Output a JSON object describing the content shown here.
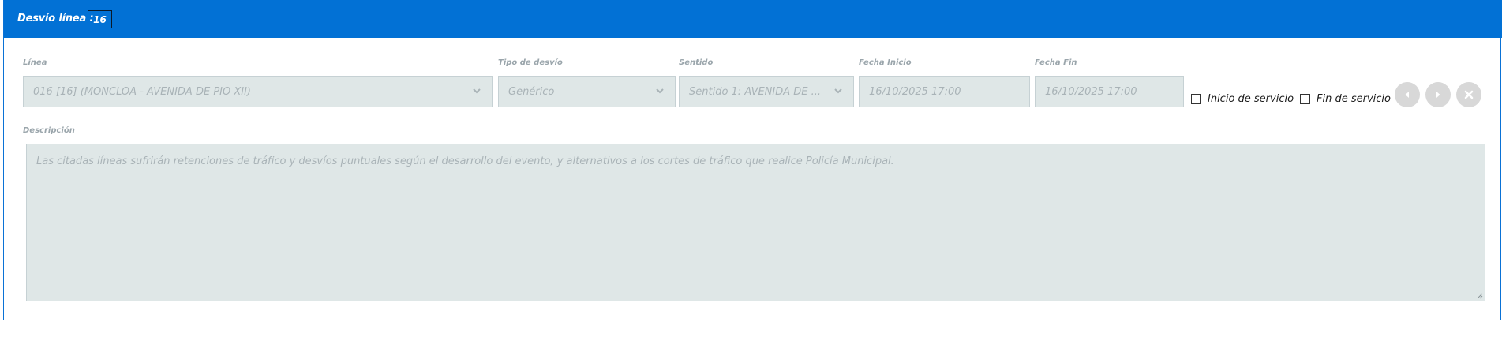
{
  "header": {
    "title": "Desvío línea :",
    "line_number": "16"
  },
  "fields": {
    "linea": {
      "label": "Línea",
      "value": "016 [16] (MONCLOA - AVENIDA DE PIO XII)"
    },
    "tipo_desvio": {
      "label": "Tipo de desvío",
      "value": "Genérico"
    },
    "sentido": {
      "label": "Sentido",
      "value": "Sentido 1: AVENIDA DE ..."
    },
    "fecha_inicio": {
      "label": "Fecha Inicio",
      "value": "16/10/2025 17:00"
    },
    "fecha_fin": {
      "label": "Fecha Fin",
      "value": "16/10/2025 17:00"
    }
  },
  "checkboxes": {
    "inicio_servicio": {
      "label": "Inicio de servicio",
      "checked": false
    },
    "fin_servicio": {
      "label": "Fin de servicio",
      "checked": false
    }
  },
  "buttons": {
    "prev_icon": "caret-left-icon",
    "next_icon": "caret-right-icon",
    "close_icon": "close-icon"
  },
  "descripcion": {
    "label": "Descripción",
    "value": "Las citadas líneas sufrirán retenciones de tráfico y desvíos puntuales según el desarrollo del evento, y alternativos a los cortes de tráfico que realice Policía Municipal."
  },
  "colors": {
    "header_bg": "#0271d5",
    "field_bg": "#dfe7e7",
    "button_bg": "#d8d8d8"
  }
}
